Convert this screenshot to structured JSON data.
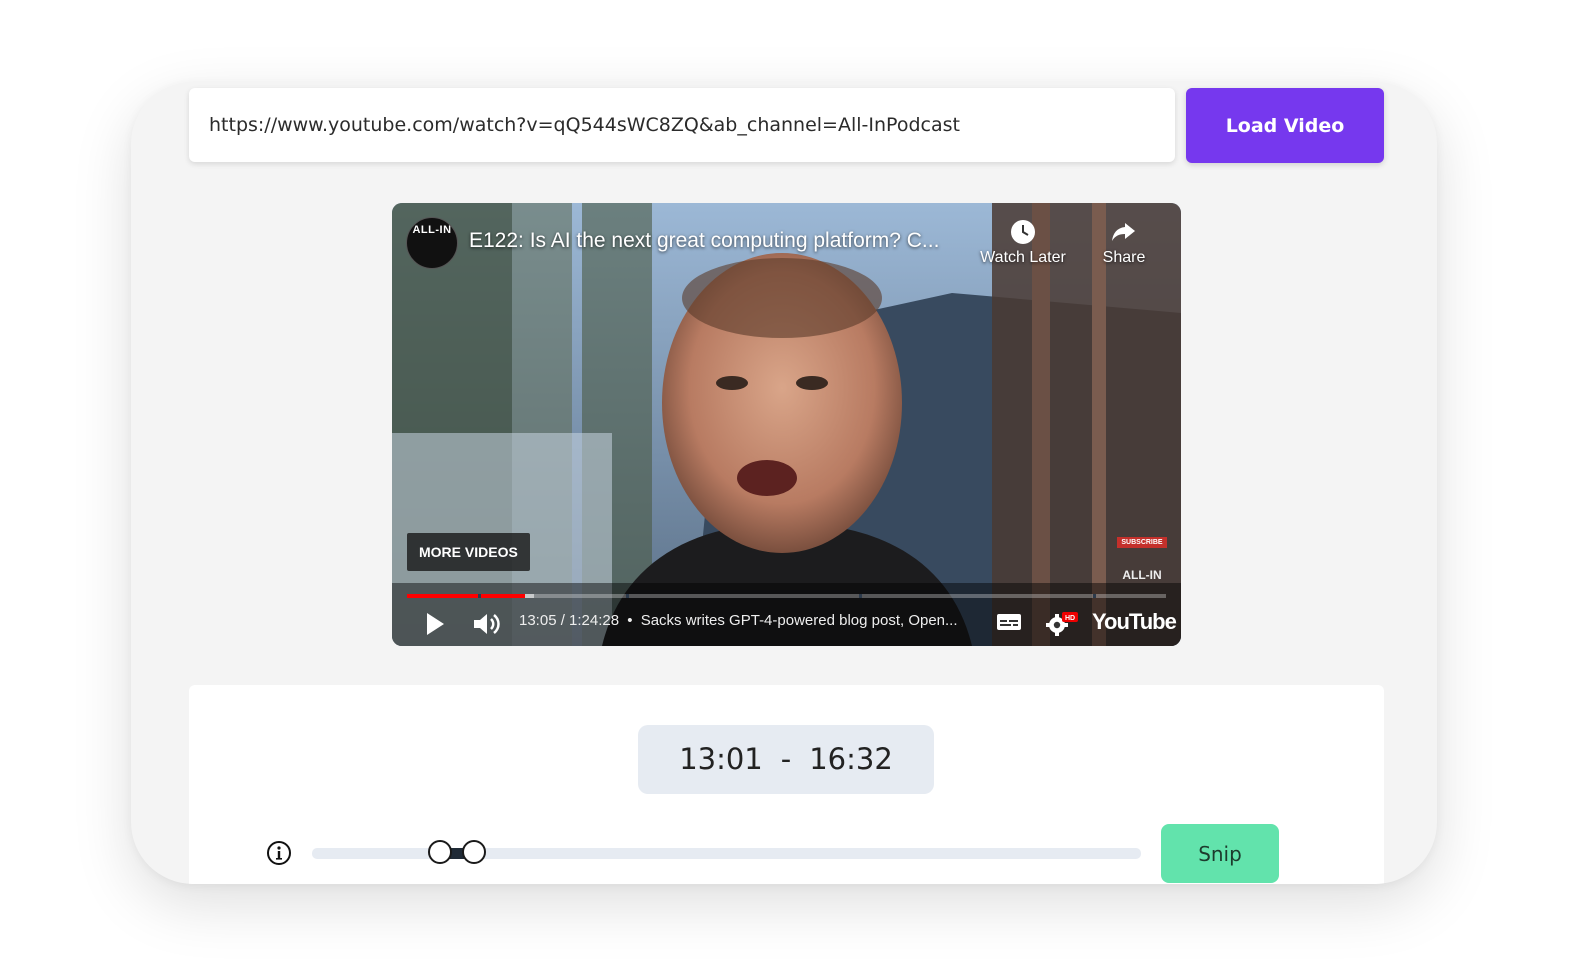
{
  "url_bar": {
    "value": "https://www.youtube.com/watch?v=qQ544sWC8ZQ&ab_channel=All-InPodcast",
    "button_label": "Load Video"
  },
  "video": {
    "channel_logo_text": "ALL-IN",
    "title": "E122: Is AI the next great computing platform? C...",
    "watch_later_label": "Watch Later",
    "share_label": "Share",
    "more_videos_label": "MORE VIDEOS",
    "watermark_subscribe": "SUBSCRIBE",
    "watermark_text": "ALL-IN",
    "time_display": "13:05 / 1:24:28",
    "separator": "•",
    "chapter_title": "Sacks writes GPT-4-powered blog post, Open...",
    "youtube_logo": "YouTube",
    "hd_badge": "HD",
    "current_time_seconds": 785,
    "duration_seconds": 5068,
    "icons": {
      "play": "play-icon",
      "volume": "volume-icon",
      "captions": "captions-icon",
      "settings": "gear-icon",
      "watch_later": "clock-icon",
      "share": "share-icon"
    }
  },
  "snip_panel": {
    "start_time": "13:01",
    "separator": "-",
    "end_time": "16:32",
    "snip_label": "Snip",
    "range_start_fraction": 0.154,
    "range_end_fraction": 0.196,
    "info_icon": "info-icon"
  },
  "colors": {
    "accent_purple": "#7638ee",
    "snip_green": "#62e3ac",
    "youtube_red": "#ff0000"
  }
}
